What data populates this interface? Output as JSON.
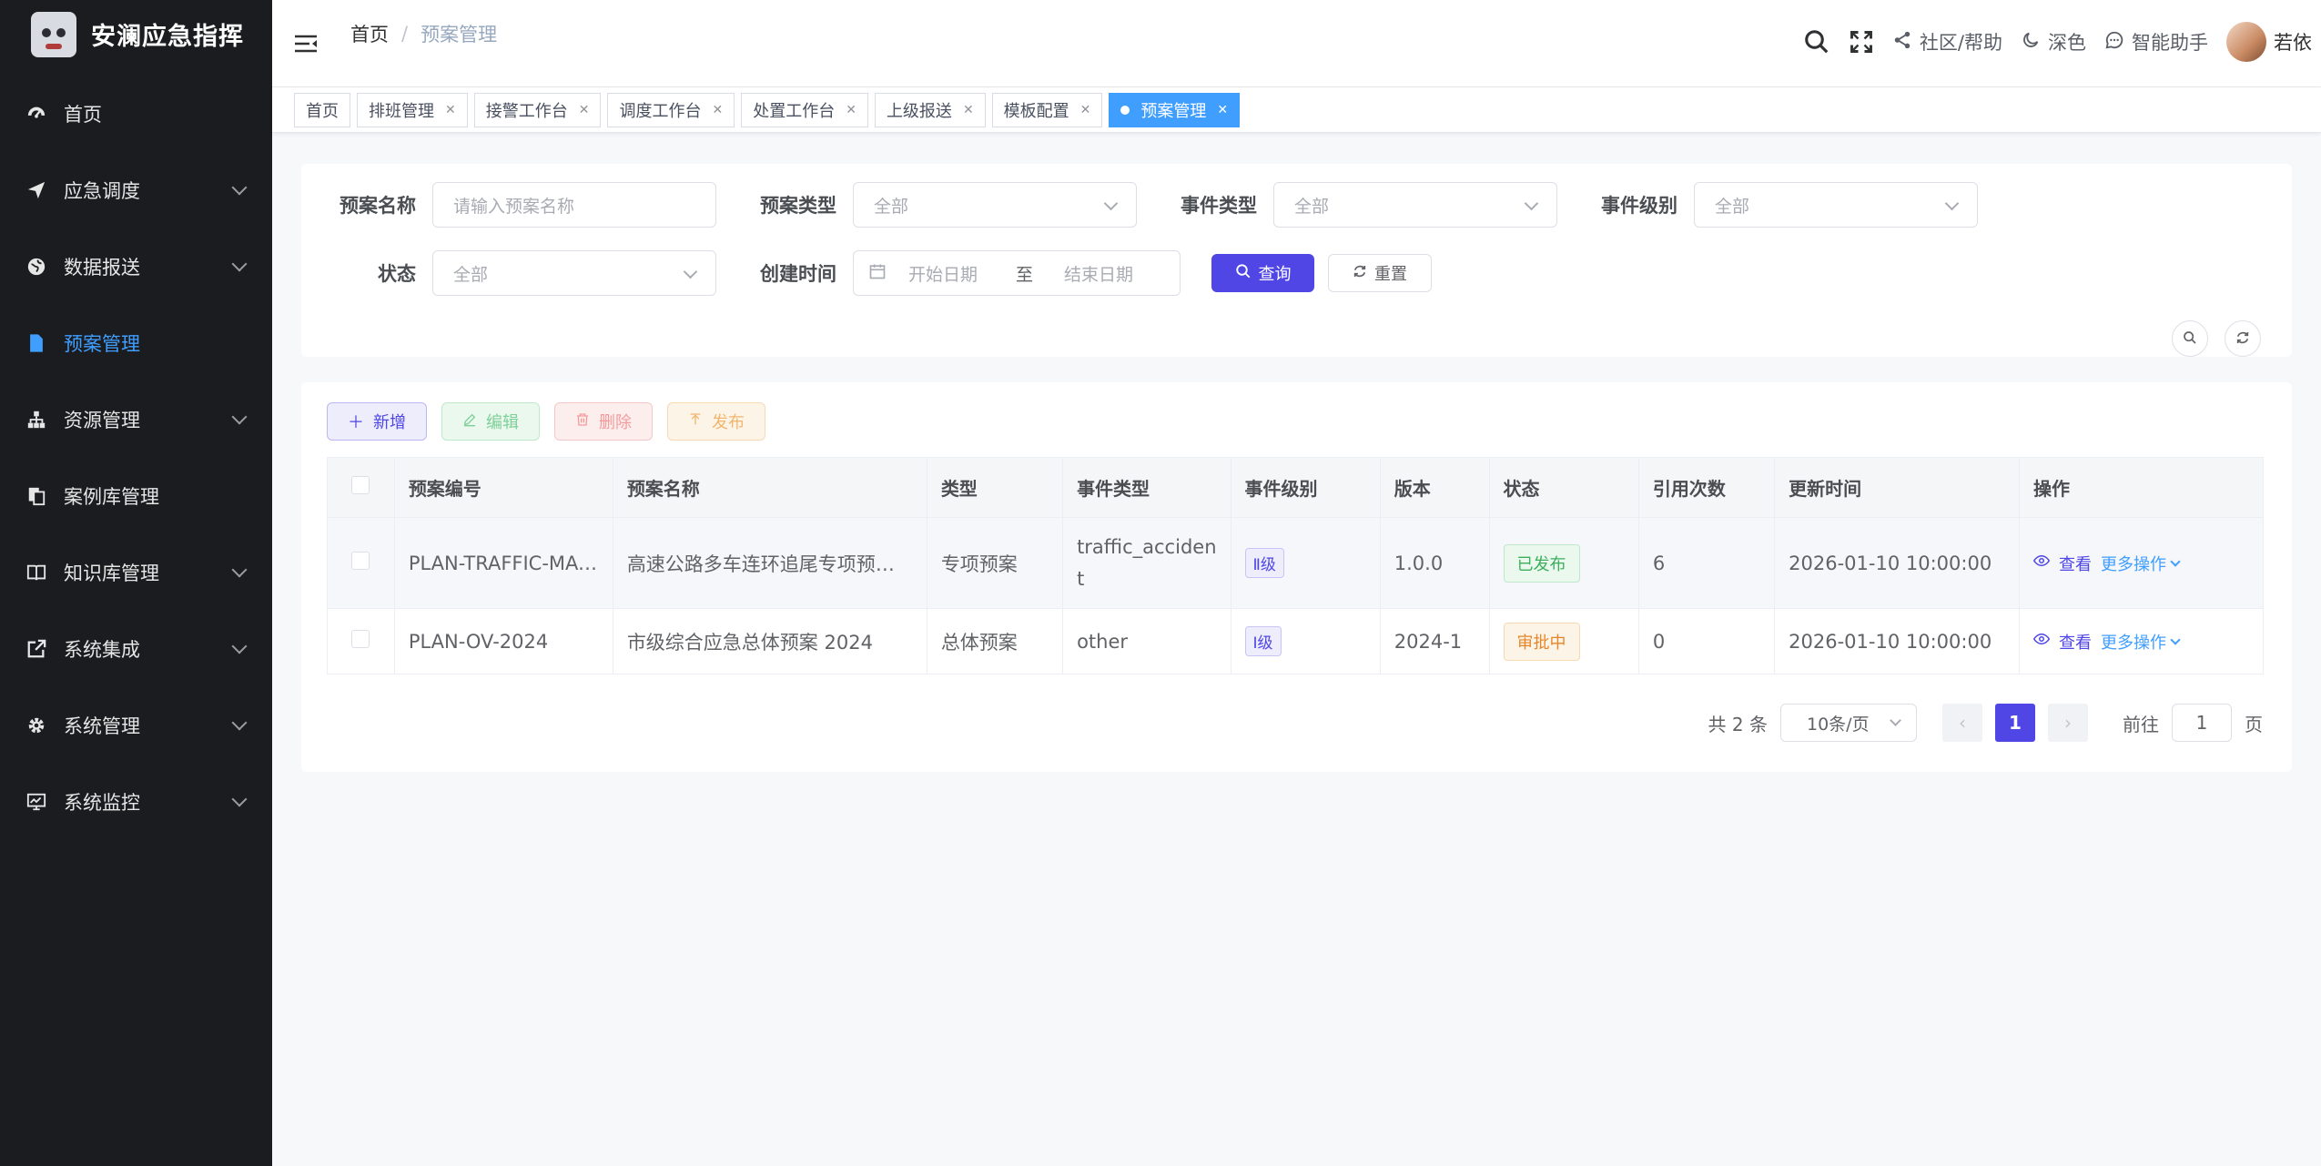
{
  "app": {
    "title": "安澜应急指挥"
  },
  "sidebar": {
    "items": [
      {
        "label": "首页",
        "icon": "dashboard-icon"
      },
      {
        "label": "应急调度",
        "icon": "send-icon"
      },
      {
        "label": "数据报送",
        "icon": "globe-icon"
      },
      {
        "label": "预案管理",
        "icon": "document-icon",
        "active": true
      },
      {
        "label": "资源管理",
        "icon": "tree-icon"
      },
      {
        "label": "案例库管理",
        "icon": "copy-icon"
      },
      {
        "label": "知识库管理",
        "icon": "book-icon"
      },
      {
        "label": "系统集成",
        "icon": "external-link-icon"
      },
      {
        "label": "系统管理",
        "icon": "gear-icon"
      },
      {
        "label": "系统监控",
        "icon": "monitor-icon"
      }
    ]
  },
  "header": {
    "breadcrumb": {
      "home": "首页",
      "sep": "/",
      "current": "预案管理"
    },
    "community": "社区/帮助",
    "theme": "深色",
    "assistant": "智能助手",
    "user": "若依"
  },
  "tags": [
    {
      "label": "首页"
    },
    {
      "label": "排班管理"
    },
    {
      "label": "接警工作台"
    },
    {
      "label": "调度工作台"
    },
    {
      "label": "处置工作台"
    },
    {
      "label": "上级报送"
    },
    {
      "label": "模板配置"
    },
    {
      "label": "预案管理",
      "active": true
    }
  ],
  "search": {
    "plan_name_label": "预案名称",
    "plan_name_placeholder": "请输入预案名称",
    "plan_type_label": "预案类型",
    "plan_type_value": "全部",
    "event_type_label": "事件类型",
    "event_type_value": "全部",
    "event_level_label": "事件级别",
    "event_level_value": "全部",
    "status_label": "状态",
    "status_value": "全部",
    "created_label": "创建时间",
    "start_placeholder": "开始日期",
    "range_sep": "至",
    "end_placeholder": "结束日期",
    "query": "查询",
    "reset": "重置"
  },
  "toolbar": {
    "add": "新增",
    "edit": "编辑",
    "delete": "删除",
    "publish": "发布"
  },
  "table": {
    "headers": [
      "预案编号",
      "预案名称",
      "类型",
      "事件类型",
      "事件级别",
      "版本",
      "状态",
      "引用次数",
      "更新时间",
      "操作"
    ],
    "rows": [
      {
        "code": "PLAN-TRAFFIC-MA-...",
        "name": "高速公路多车连环追尾专项预案...",
        "type": "专项预案",
        "event_type_1": "traffic_acciden",
        "event_type_2": "t",
        "level": "Ⅱ级",
        "version": "1.0.0",
        "status": "已发布",
        "refs": "6",
        "updated": "2026-01-10 10:00:00",
        "view": "查看",
        "more": "更多操作"
      },
      {
        "code": "PLAN-OV-2024",
        "name": "市级综合应急总体预案 2024",
        "type": "总体预案",
        "event_type_1": "other",
        "event_type_2": "",
        "level": "Ⅰ级",
        "version": "2024-1",
        "status": "审批中",
        "refs": "0",
        "updated": "2026-01-10 10:00:00",
        "view": "查看",
        "more": "更多操作"
      }
    ]
  },
  "pagination": {
    "total": "共 2 条",
    "page_size": "10条/页",
    "current": "1",
    "goto_prefix": "前往",
    "goto_value": "1",
    "goto_suffix": "页"
  },
  "colors": {
    "sidebar_bg": "#1b1c1f",
    "active_menu": "#409eff",
    "primary": "#4f46e5",
    "published": "#3cae5c",
    "reviewing": "#e6862a"
  }
}
